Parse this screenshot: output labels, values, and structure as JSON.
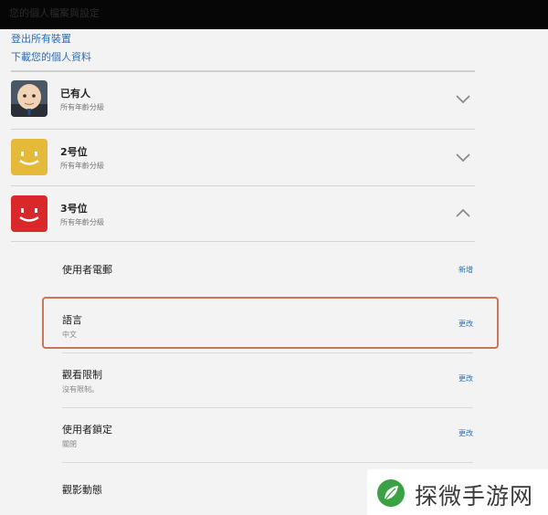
{
  "header": {
    "title": "您的個人檔案與設定"
  },
  "account_links": {
    "sign_out_all": "登出所有裝置",
    "download_data": "下載您的個人資料"
  },
  "profiles": [
    {
      "name": "已有人",
      "subtitle": "所有年齡分級",
      "avatar": "boss-baby-avatar",
      "expanded": false
    },
    {
      "name": "2号位",
      "subtitle": "所有年齡分級",
      "avatar": "yellow-smile-avatar",
      "color": "#e5b93a",
      "expanded": false
    },
    {
      "name": "3号位",
      "subtitle": "所有年齡分級",
      "avatar": "red-smile-avatar",
      "color": "#d8282b",
      "expanded": true
    }
  ],
  "profile_settings": {
    "email": {
      "label": "使用者電郵",
      "action": "新增"
    },
    "language": {
      "label": "語言",
      "value": "中文",
      "action": "更改"
    },
    "restrictions": {
      "label": "觀看限制",
      "value": "沒有限制。",
      "action": "更改"
    },
    "lock": {
      "label": "使用者鎖定",
      "value": "關閉",
      "action": "更改"
    },
    "activity": {
      "label": "觀影動態"
    }
  },
  "watermark": {
    "text": "探微手游网",
    "icon": "leaf-logo-icon"
  },
  "colors": {
    "link": "#2f6db3",
    "highlight": "#c9755c",
    "background": "#f3f3f3"
  }
}
